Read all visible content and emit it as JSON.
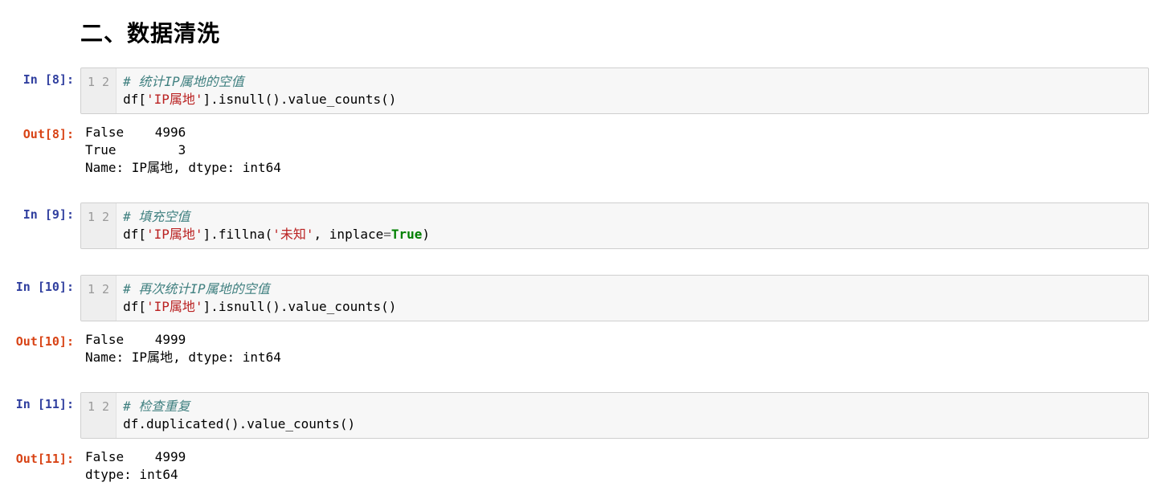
{
  "heading": "二、数据清洗",
  "cells": [
    {
      "in_prompt": "In [8]:",
      "gutter": [
        "1",
        "2"
      ],
      "code_lines": [
        [
          {
            "cls": "tok-comment",
            "t": "# 统计IP属地的空值"
          }
        ],
        [
          {
            "t": "df["
          },
          {
            "cls": "tok-str",
            "t": "'IP属地'"
          },
          {
            "t": "].isnull().value_counts()"
          }
        ]
      ],
      "out_prompt": "Out[8]:",
      "output": "False    4996\nTrue        3\nName: IP属地, dtype: int64"
    },
    {
      "in_prompt": "In [9]:",
      "gutter": [
        "1",
        "2"
      ],
      "code_lines": [
        [
          {
            "cls": "tok-comment",
            "t": "# 填充空值"
          }
        ],
        [
          {
            "t": "df["
          },
          {
            "cls": "tok-str",
            "t": "'IP属地'"
          },
          {
            "t": "].fillna("
          },
          {
            "cls": "tok-str",
            "t": "'未知'"
          },
          {
            "t": ", inplace"
          },
          {
            "cls": "tok-op",
            "t": "="
          },
          {
            "cls": "tok-kw",
            "t": "True"
          },
          {
            "t": ")"
          }
        ]
      ]
    },
    {
      "in_prompt": "In [10]:",
      "gutter": [
        "1",
        "2"
      ],
      "code_lines": [
        [
          {
            "cls": "tok-comment",
            "t": "# 再次统计IP属地的空值"
          }
        ],
        [
          {
            "t": "df["
          },
          {
            "cls": "tok-str",
            "t": "'IP属地'"
          },
          {
            "t": "].isnull().value_counts()"
          }
        ]
      ],
      "out_prompt": "Out[10]:",
      "output": "False    4999\nName: IP属地, dtype: int64"
    },
    {
      "in_prompt": "In [11]:",
      "gutter": [
        "1",
        "2"
      ],
      "code_lines": [
        [
          {
            "cls": "tok-comment",
            "t": "# 检查重复"
          }
        ],
        [
          {
            "t": "df.duplicated().value_counts()"
          }
        ]
      ],
      "out_prompt": "Out[11]:",
      "output": "False    4999\ndtype: int64"
    }
  ]
}
